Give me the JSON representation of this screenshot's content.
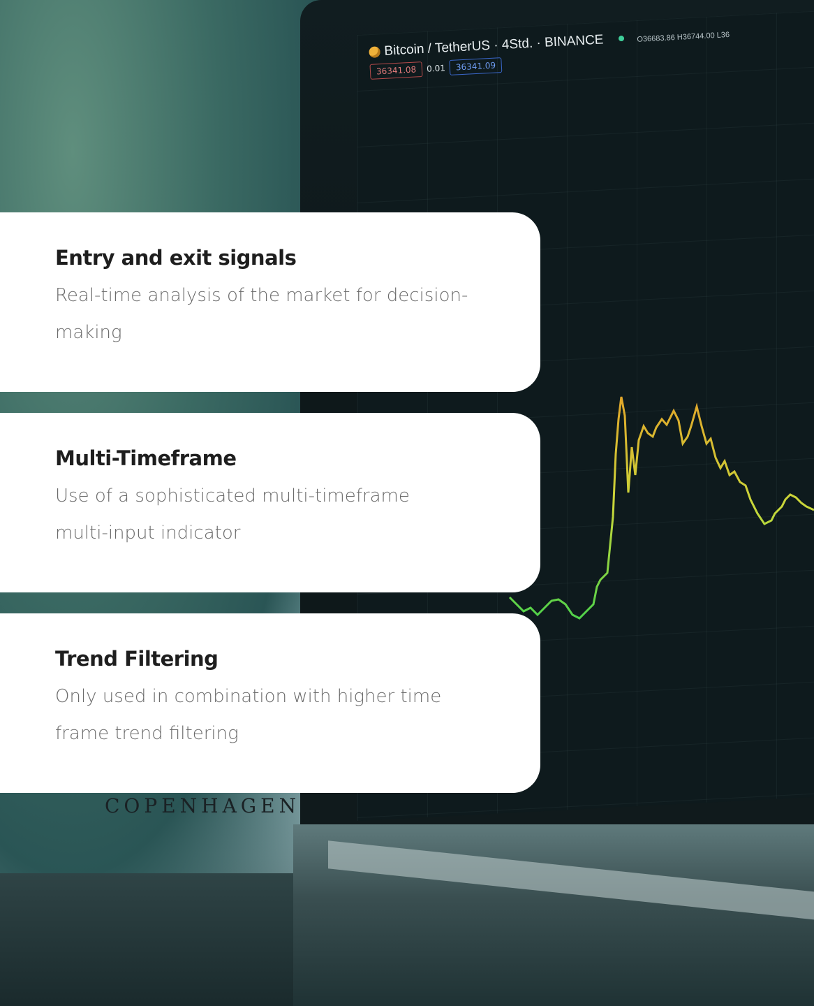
{
  "background": {
    "ticker": {
      "title": "Bitcoin / TetherUS · 4Std. · BINANCE",
      "ohlc": "O36683.86 H36744.00 L36",
      "bid": "36341.08",
      "spread": "0.01",
      "ask": "36341.09"
    },
    "sign_text": "COPENHAGEN",
    "colors": {
      "accent_stripe": "#1d6f7c",
      "chart_line_high": "#e2a62a",
      "chart_line_low": "#4fd14a"
    }
  },
  "features": [
    {
      "title": "Entry and exit signals",
      "description": "Real-time analysis of the market for decision-making"
    },
    {
      "title": "Multi-Timeframe",
      "description": "Use of a sophisticated multi-timeframe multi-input indicator"
    },
    {
      "title": "Trend Filtering",
      "description": "Only used in combination with higher time frame trend filtering"
    }
  ]
}
